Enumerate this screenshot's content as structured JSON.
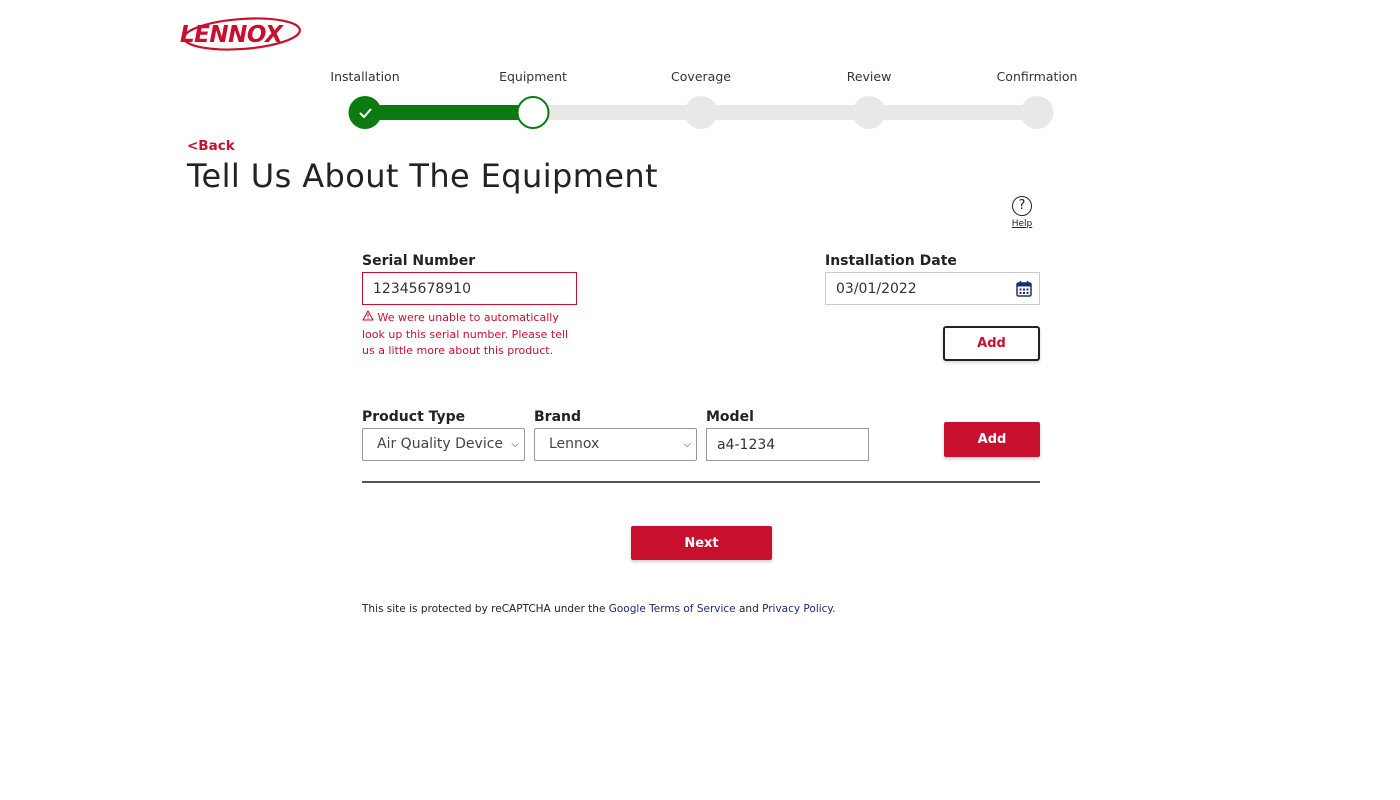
{
  "brand": {
    "logo_text": "LENNOX",
    "accent_color": "#c8102e",
    "progress_color": "#0a7a11"
  },
  "stepper": {
    "steps": [
      {
        "label": "Installation",
        "state": "complete"
      },
      {
        "label": "Equipment",
        "state": "current"
      },
      {
        "label": "Coverage",
        "state": "upcoming"
      },
      {
        "label": "Review",
        "state": "upcoming"
      },
      {
        "label": "Confirmation",
        "state": "upcoming"
      }
    ]
  },
  "nav": {
    "back_label": "<Back"
  },
  "page": {
    "title": "Tell Us About The Equipment"
  },
  "help": {
    "icon": "question-circle-icon",
    "glyph": "?",
    "label": "Help"
  },
  "serial": {
    "label": "Serial Number",
    "value": "12345678910",
    "error": "We were unable to automatically look up this serial number. Please tell us a little more about this product.",
    "error_icon": "warning-triangle-icon"
  },
  "install_date": {
    "label": "Installation Date",
    "value": "03/01/2022",
    "icon": "calendar-icon"
  },
  "add_outline": {
    "label": "Add"
  },
  "product": {
    "type_label": "Product Type",
    "type_value": "Air Quality Device",
    "brand_label": "Brand",
    "brand_value": "Lennox",
    "model_label": "Model",
    "model_value": "a4-1234"
  },
  "add_primary": {
    "label": "Add"
  },
  "next": {
    "label": "Next"
  },
  "footer": {
    "prefix": "This site is protected by reCAPTCHA under the ",
    "terms_link": "Google Terms of Service",
    "and": " and ",
    "privacy_link": "Privacy Policy",
    "suffix": "."
  }
}
